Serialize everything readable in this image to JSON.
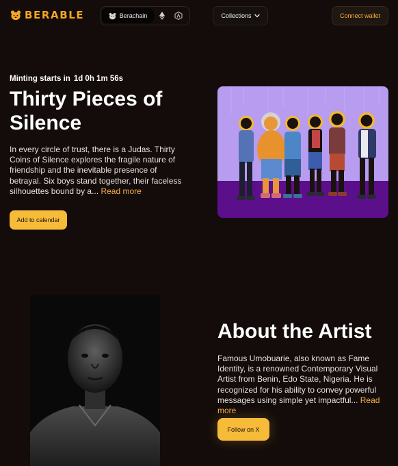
{
  "header": {
    "logo_text": "BERABLE",
    "chain_switch": {
      "active_label": "Berachain",
      "options": [
        "bera-icon",
        "ethereum-icon",
        "arbitrum-icon"
      ]
    },
    "collections_label": "Collections",
    "connect_label": "Connect wallet"
  },
  "mint": {
    "countdown_label": "Minting starts in",
    "countdown_value": "1d 0h 1m 56s",
    "title": "Thirty Pieces of Silence",
    "description": "In every circle of trust, there is a Judas. Thirty Coins of Silence explores the fragile nature of friendship and the inevitable presence of betrayal. Six boys stand together, their faceless silhouettes bound by a...",
    "read_more": "Read more",
    "calendar_button": "Add to calendar"
  },
  "artist": {
    "title": "About the Artist",
    "description": "Famous Umobuarie, also known as Fame Identity, is a renowned Contemporary Visual Artist from Benin, Edo State, Nigeria. He is recognized for his ability to convey powerful messages using simple yet impactful...",
    "read_more": "Read more",
    "follow_button": "Follow on X"
  },
  "colors": {
    "background": "#130c0a",
    "accent": "#f7bb3a",
    "logo": "#f5a623",
    "artwork_wall": "#b79cf0",
    "artwork_floor": "#5c0f8a"
  }
}
